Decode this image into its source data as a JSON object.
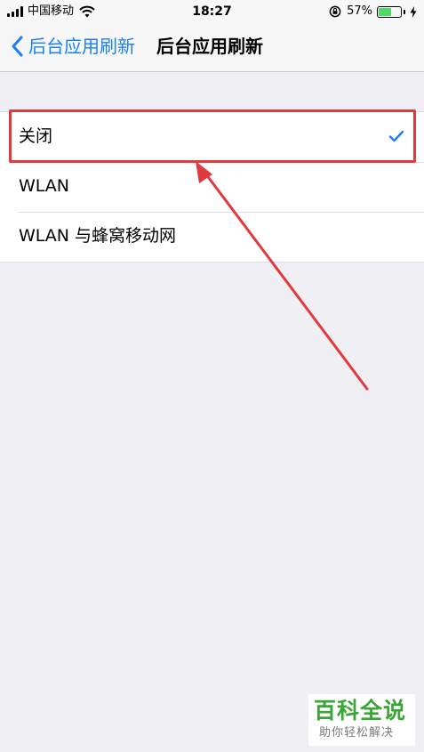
{
  "status_bar": {
    "carrier": "中国移动",
    "time": "18:27",
    "battery_percent": "57%",
    "battery_level": 0.57,
    "battery_color": "#4cd964"
  },
  "nav": {
    "back_label": "后台应用刷新",
    "title": "后台应用刷新",
    "accent_color": "#1a7ff5"
  },
  "options": [
    {
      "label": "关闭",
      "selected": true
    },
    {
      "label": "WLAN",
      "selected": false
    },
    {
      "label": "WLAN 与蜂窝移动网",
      "selected": false
    }
  ],
  "annotation": {
    "color": "#e0393e"
  },
  "watermark": {
    "main": "百科全说",
    "sub": "助你轻松解决"
  }
}
